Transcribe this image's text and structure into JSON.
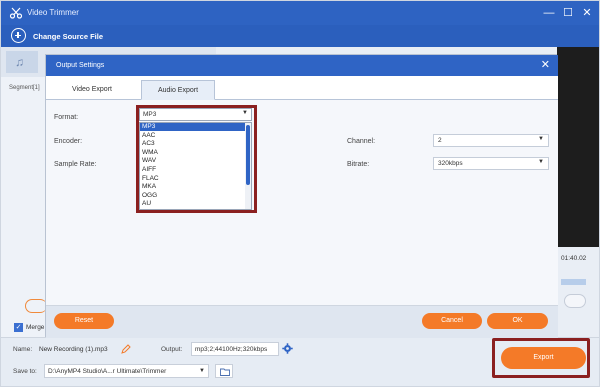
{
  "window": {
    "title": "Video Trimmer"
  },
  "toolbar": {
    "change_source_label": "Change Source File"
  },
  "background": {
    "segment_label": "Segment[1]",
    "timecode": "01:40.02",
    "merge_label": "Merge"
  },
  "modal": {
    "title": "Output Settings",
    "tabs": [
      {
        "label": "Video Export"
      },
      {
        "label": "Audio Export"
      }
    ],
    "fields": {
      "format_label": "Format:",
      "encoder_label": "Encoder:",
      "sample_rate_label": "Sample Rate:",
      "channel_label": "Channel:",
      "bitrate_label": "Bitrate:"
    },
    "format": {
      "selected": "MP3",
      "options": [
        "MP3",
        "AAC",
        "AC3",
        "WMA",
        "WAV",
        "AIFF",
        "FLAC",
        "MKA",
        "OGG",
        "AU"
      ]
    },
    "channel_value": "2",
    "bitrate_value": "320kbps",
    "buttons": {
      "reset": "Reset",
      "cancel": "Cancel",
      "ok": "OK"
    }
  },
  "bottom": {
    "name_label": "Name:",
    "name_value": "New Recording (1).mp3",
    "output_label": "Output:",
    "output_value": "mp3;2;44100Hz;320kbps",
    "save_label": "Save to:",
    "save_path": "D:\\AnyMP4 Studio\\A...r Ultimate\\Trimmer",
    "export_label": "Export"
  },
  "colors": {
    "titlebar": "#2e63c2",
    "accent_orange": "#f47a28",
    "highlight_red": "#8b2020",
    "selection_blue": "#2f64c5"
  }
}
